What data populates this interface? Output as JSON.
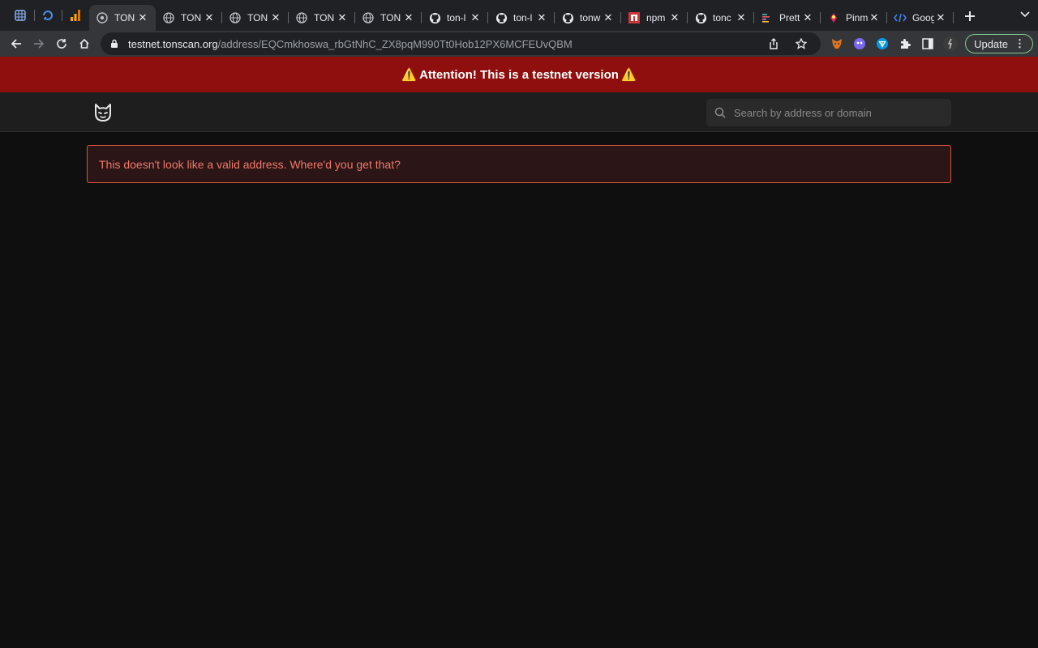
{
  "browser": {
    "tabs": [
      {
        "title": "TON",
        "icon": "ton-icon",
        "active": true
      },
      {
        "title": "TON",
        "icon": "globe-icon"
      },
      {
        "title": "TON",
        "icon": "globe-icon"
      },
      {
        "title": "TON",
        "icon": "globe-icon"
      },
      {
        "title": "TON",
        "icon": "globe-icon"
      },
      {
        "title": "ton-l",
        "icon": "github-icon"
      },
      {
        "title": "ton-l",
        "icon": "github-icon"
      },
      {
        "title": "tonw",
        "icon": "github-icon"
      },
      {
        "title": "npm",
        "icon": "npm-icon"
      },
      {
        "title": "tonc",
        "icon": "github-icon"
      },
      {
        "title": "Prett",
        "icon": "prettier-icon"
      },
      {
        "title": "Pinm",
        "icon": "pinmap-icon"
      },
      {
        "title": "Goog",
        "icon": "code-icon"
      }
    ],
    "url_host": "testnet.tonscan.org",
    "url_path": "/address/EQCmkhoswa_rbGtNhC_ZX8pqM990Tt0Hob12PX6MCFEUvQBM",
    "update_label": "Update"
  },
  "banner": {
    "text": "Attention! This is a testnet version",
    "warn_glyph": "⚠️"
  },
  "header": {
    "search_placeholder": "Search by address or domain"
  },
  "alert": {
    "text": "This doesn't look like a valid address. Where'd you get that?"
  },
  "colors": {
    "banner_bg": "#8f0e0e",
    "alert_border": "#d4553f",
    "alert_text": "#f0796a"
  }
}
